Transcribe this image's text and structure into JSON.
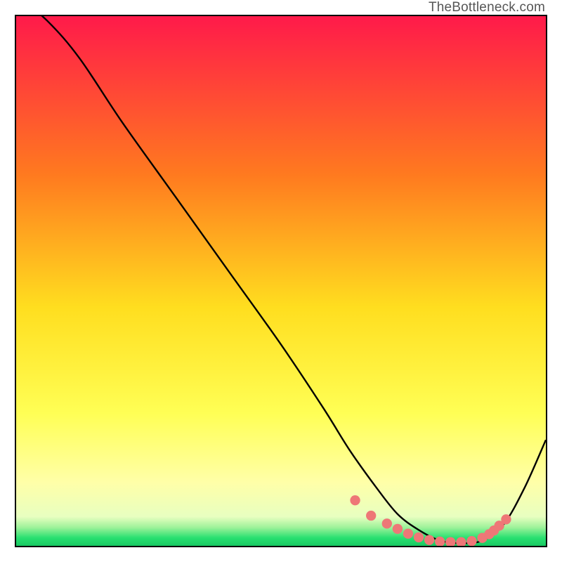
{
  "watermark": "TheBottleneck.com",
  "colors": {
    "top": "#ff1a4a",
    "mid_orange": "#ff9a1f",
    "mid_yellow": "#ffe81f",
    "pale_yellow": "#ffff9a",
    "green": "#1fe06a",
    "border": "#000000",
    "curve": "#000000",
    "dot_fill": "#ee7777",
    "dot_stroke": "#d65c5c"
  },
  "chart_data": {
    "type": "line",
    "title": "",
    "xlabel": "",
    "ylabel": "",
    "xlim": [
      0,
      100
    ],
    "ylim": [
      0,
      100
    ],
    "series": [
      {
        "name": "bottleneck-curve",
        "x": [
          0,
          6,
          12,
          20,
          30,
          40,
          50,
          58,
          63,
          68,
          72,
          76,
          80,
          84,
          88,
          92,
          96,
          100
        ],
        "values": [
          104,
          99,
          92,
          80,
          66,
          52,
          38,
          26,
          18,
          11,
          6,
          3,
          1,
          0.5,
          1,
          4,
          11,
          20
        ]
      }
    ],
    "markers": {
      "name": "optimal-range-dots",
      "x": [
        64,
        67,
        70,
        72,
        74,
        76,
        78,
        80,
        82,
        84,
        86,
        88,
        89.3,
        90.2,
        91.2,
        92.5
      ],
      "values": [
        8.6,
        5.7,
        4.2,
        3.2,
        2.3,
        1.6,
        1.1,
        0.8,
        0.7,
        0.7,
        0.9,
        1.5,
        2.2,
        2.9,
        3.8,
        5.0
      ]
    },
    "gradient_stops": [
      {
        "offset": 0,
        "color": "#ff1a4a"
      },
      {
        "offset": 0.3,
        "color": "#ff7a1f"
      },
      {
        "offset": 0.55,
        "color": "#ffde1f"
      },
      {
        "offset": 0.75,
        "color": "#ffff55"
      },
      {
        "offset": 0.88,
        "color": "#ffffa8"
      },
      {
        "offset": 0.945,
        "color": "#e8ffc0"
      },
      {
        "offset": 0.965,
        "color": "#9ff29a"
      },
      {
        "offset": 0.985,
        "color": "#28e070"
      },
      {
        "offset": 1.0,
        "color": "#18c862"
      }
    ]
  }
}
